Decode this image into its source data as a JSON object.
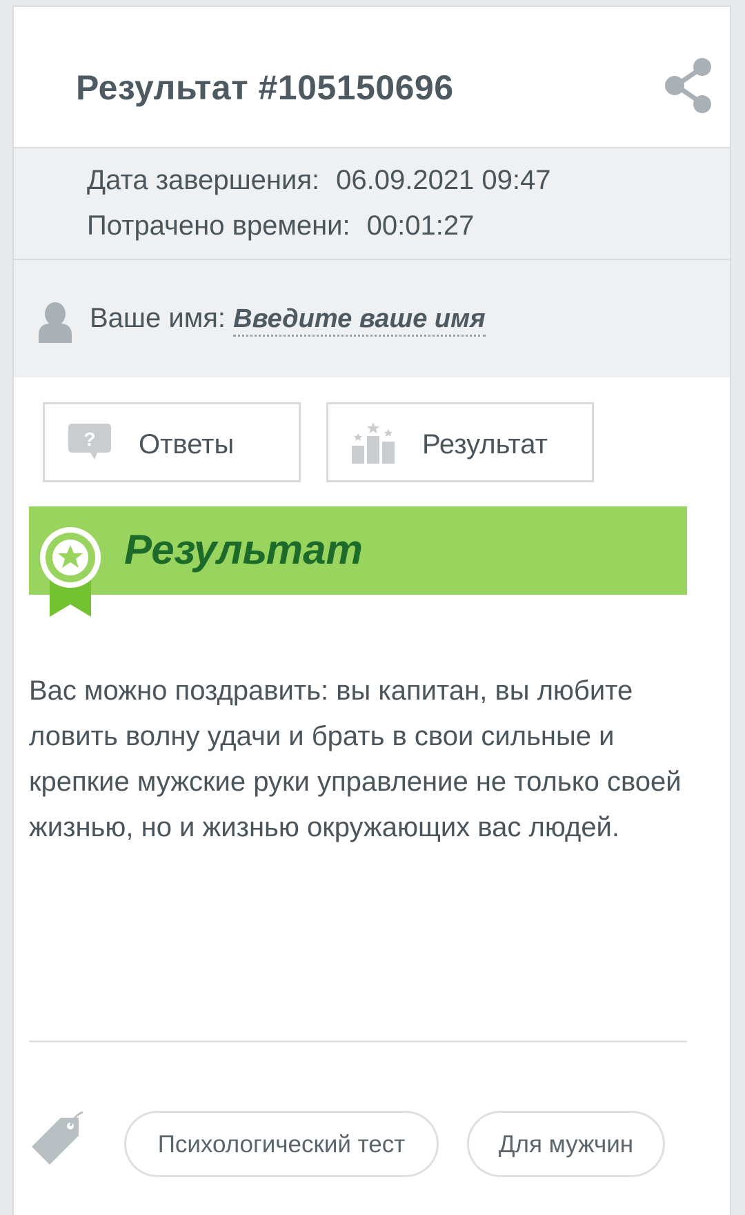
{
  "header": {
    "title": "Результат #105150696"
  },
  "meta": {
    "date_label": "Дата завершения:",
    "date_value": "06.09.2021 09:47",
    "time_label": "Потрачено времени:",
    "time_value": "00:01:27"
  },
  "name": {
    "label": "Ваше имя:",
    "link": "Введите ваше имя"
  },
  "buttons": {
    "answers": "Ответы",
    "result": "Результат"
  },
  "banner": {
    "title": "Результат"
  },
  "result_text": "Вас можно поздравить: вы капитан, вы любите ловить волну удачи и брать в свои сильные и крепкие мужские руки управление не только своей жизнью, но и жизнью окружающих вас людей.",
  "tags": [
    "Психологический тест",
    "Для мужчин"
  ],
  "colors": {
    "banner_bg": "#99d45f",
    "banner_text": "#1d6b2a",
    "icon_gray": "#a9b1b6"
  },
  "icons": {
    "share": "share-icon",
    "user": "user-icon",
    "answers": "question-bubble-icon",
    "result": "podium-stars-icon",
    "badge": "award-ribbon-icon",
    "tag": "tag-icon"
  }
}
